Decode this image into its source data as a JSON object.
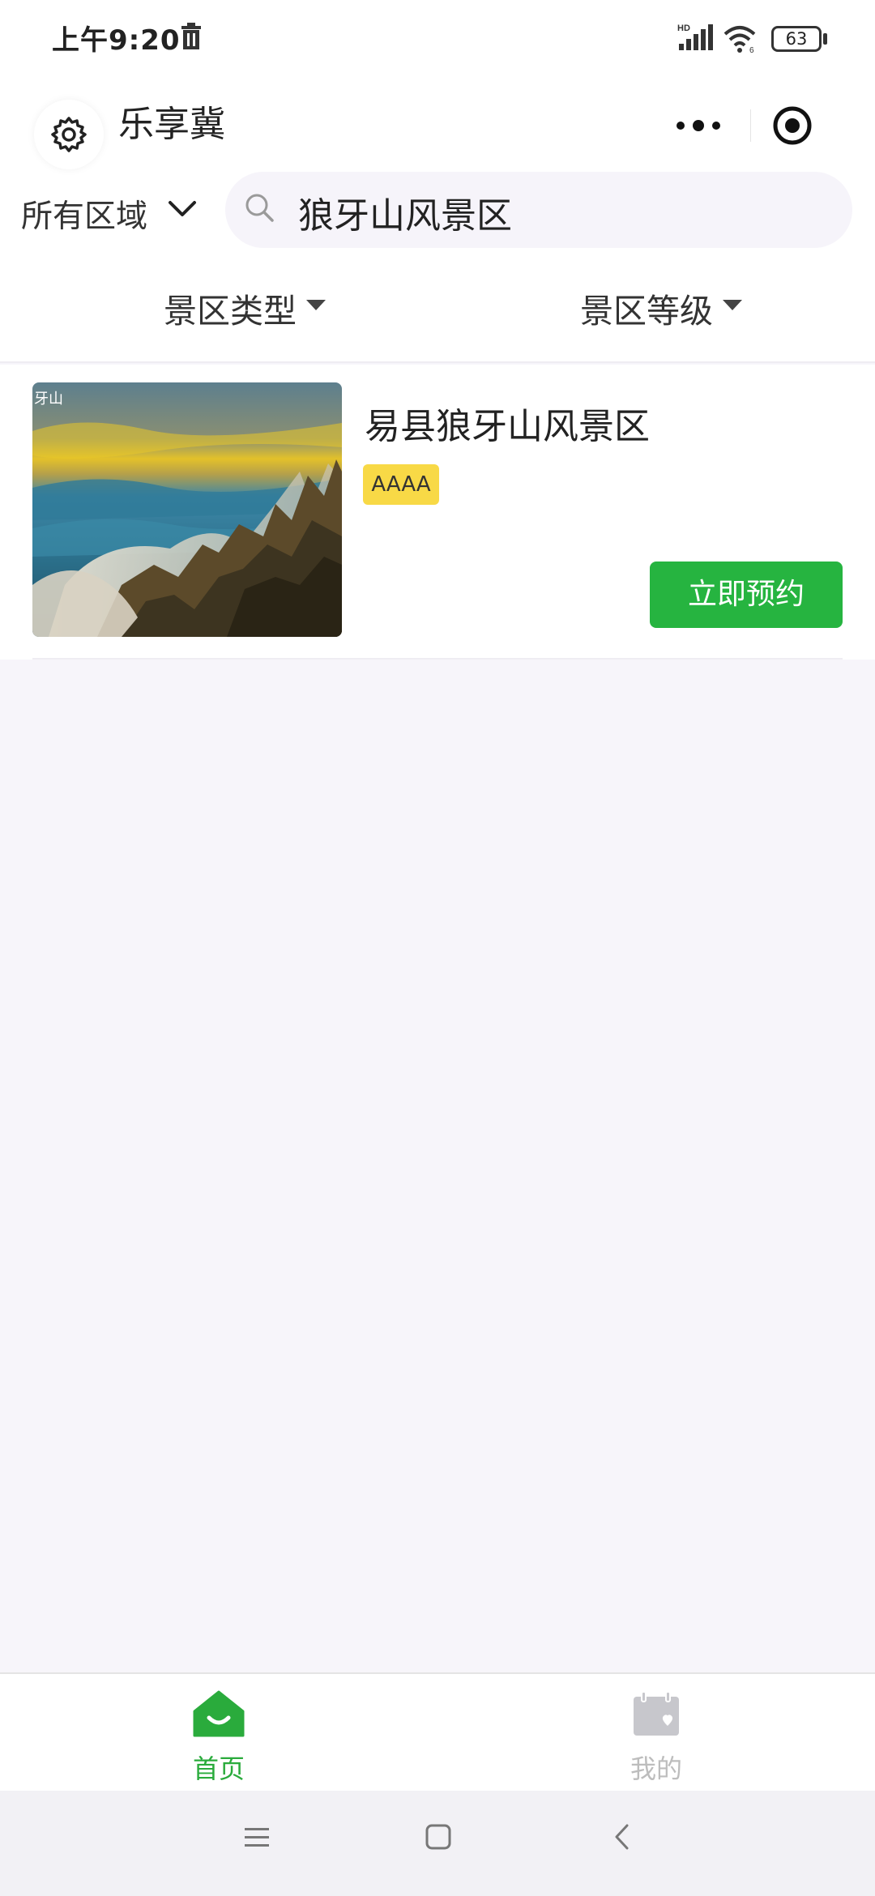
{
  "status_bar": {
    "time": "上午9:20",
    "battery": "63"
  },
  "nav": {
    "title": "乐享冀"
  },
  "filter": {
    "region": "所有区域",
    "search_value": "狼牙山风景区"
  },
  "tabs_filter": [
    {
      "label": "景区类型"
    },
    {
      "label": "景区等级"
    }
  ],
  "results": [
    {
      "name": "易县狼牙山风景区",
      "grade": "AAAA",
      "image_caption": "牙山",
      "action": "立即预约"
    }
  ],
  "tab_bar": [
    {
      "label": "首页",
      "icon": "home-icon",
      "active": true
    },
    {
      "label": "我的",
      "icon": "calendar-heart-icon",
      "active": false
    }
  ],
  "colors": {
    "accent": "#26b440",
    "badge": "#f8d946",
    "tab_active": "#2aab3c",
    "tab_inactive": "#bdbdbd"
  }
}
